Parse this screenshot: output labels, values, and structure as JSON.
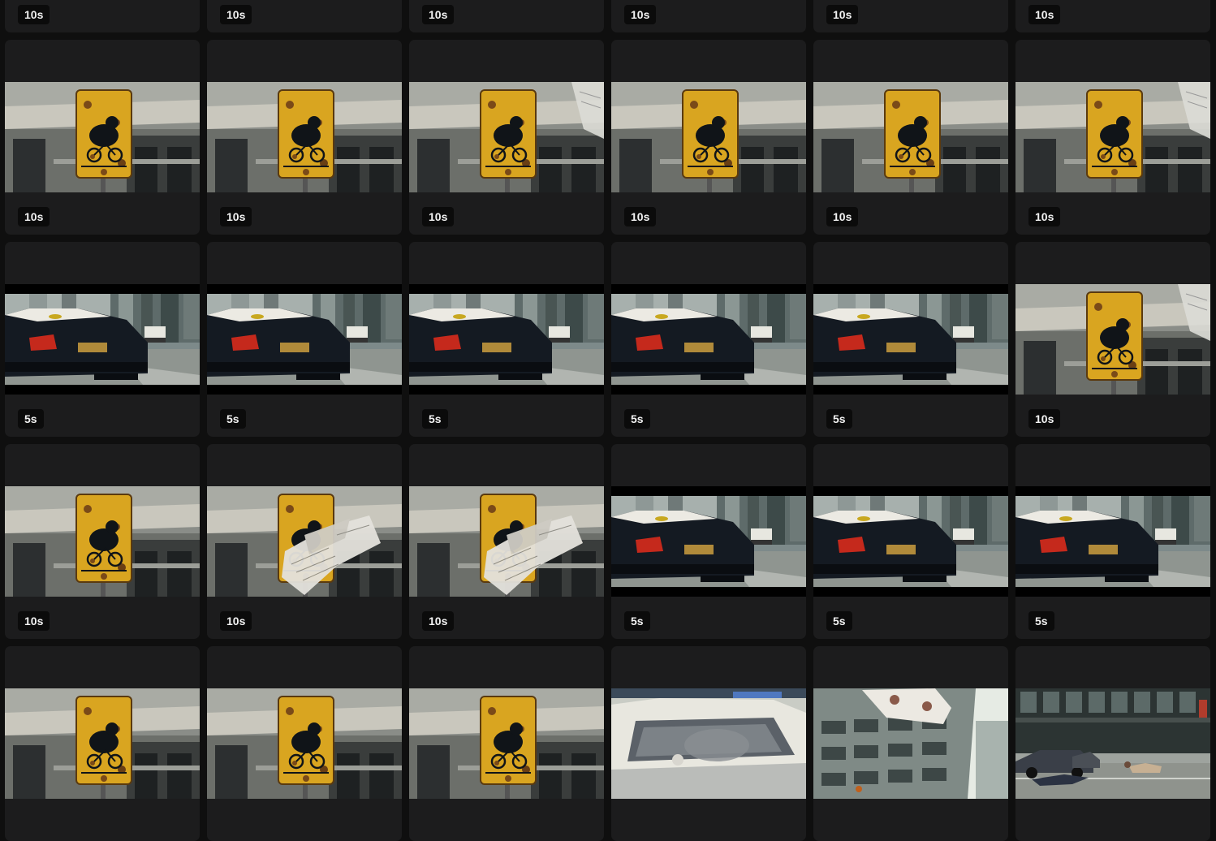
{
  "grid": {
    "rows": [
      [
        {
          "scene": "top-cut",
          "duration": "10s"
        },
        {
          "scene": "top-cut",
          "duration": "10s"
        },
        {
          "scene": "top-cut",
          "duration": "10s"
        },
        {
          "scene": "top-cut",
          "duration": "10s"
        },
        {
          "scene": "top-cut",
          "duration": "10s"
        },
        {
          "scene": "top-cut",
          "duration": "10s"
        }
      ],
      [
        {
          "scene": "bear-sign",
          "duration": "10s"
        },
        {
          "scene": "bear-sign",
          "duration": "10s"
        },
        {
          "scene": "bear-sign-paper-corner",
          "duration": "10s"
        },
        {
          "scene": "bear-sign",
          "duration": "10s"
        },
        {
          "scene": "bear-sign",
          "duration": "10s"
        },
        {
          "scene": "bear-sign-paper-corner",
          "duration": "10s"
        }
      ],
      [
        {
          "scene": "police-car",
          "duration": "5s"
        },
        {
          "scene": "police-car",
          "duration": "5s"
        },
        {
          "scene": "police-car",
          "duration": "5s"
        },
        {
          "scene": "police-car",
          "duration": "5s"
        },
        {
          "scene": "police-car",
          "duration": "5s"
        },
        {
          "scene": "bear-sign-paper-corner",
          "duration": "10s"
        }
      ],
      [
        {
          "scene": "bear-sign",
          "duration": "10s"
        },
        {
          "scene": "bear-sign-newspaper",
          "duration": "10s"
        },
        {
          "scene": "bear-sign-newspaper",
          "duration": "10s"
        },
        {
          "scene": "police-car",
          "duration": "5s"
        },
        {
          "scene": "police-car",
          "duration": "5s"
        },
        {
          "scene": "police-car",
          "duration": "5s"
        }
      ],
      [
        {
          "scene": "bear-sign",
          "duration": ""
        },
        {
          "scene": "bear-sign",
          "duration": ""
        },
        {
          "scene": "bear-sign",
          "duration": ""
        },
        {
          "scene": "car-window",
          "duration": ""
        },
        {
          "scene": "building-paper",
          "duration": ""
        },
        {
          "scene": "street-people",
          "duration": ""
        }
      ]
    ]
  },
  "colors": {
    "page_bg": "#0f0f0f",
    "card_bg": "#1c1c1d",
    "badge_bg": "#0b0b0b",
    "badge_text": "#f2f2f2",
    "sign_yellow": "#d9a520",
    "police_car": "#141a22"
  }
}
